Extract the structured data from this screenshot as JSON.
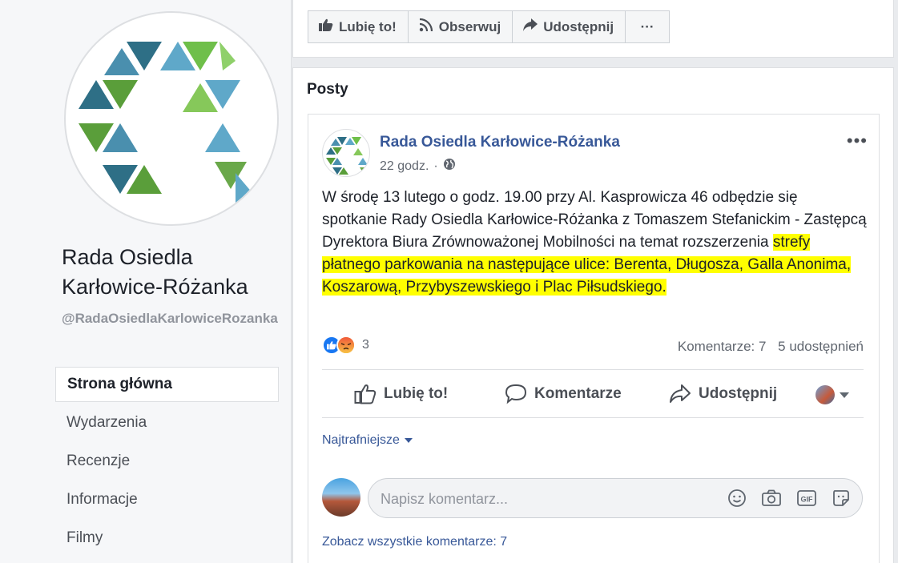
{
  "page": {
    "name": "Rada Osiedla Karłowice-Różanka",
    "handle": "@RadaOsiedlaKarlowiceRozanka"
  },
  "nav": {
    "items": [
      {
        "label": "Strona główna"
      },
      {
        "label": "Wydarzenia"
      },
      {
        "label": "Recenzje"
      },
      {
        "label": "Informacje"
      },
      {
        "label": "Filmy"
      }
    ]
  },
  "top_actions": {
    "like": "Lubię to!",
    "follow": "Obserwuj",
    "share": "Udostępnij",
    "more": "···"
  },
  "posts": {
    "title": "Posty",
    "post": {
      "author": "Rada Osiedla Karłowice-Różanka",
      "time": "22 godz.",
      "separator": "·",
      "text_plain": "W środę 13 lutego o godz. 19.00 przy Al. Kasprowicza 46 odbędzie się spotkanie Rady Osiedla Karłowice-Różanka z Tomaszem Stefanickim - Zastępcą Dyrektora Biura Zrównoważonej Mobilności na temat rozszerzenia ",
      "text_highlighted": "strefy płatnego parkowania na następujące ulice: Berenta, Długosza, Galla Anonima, Koszarową, Przybyszewskiego i Plac Piłsudskiego.",
      "reaction_count": "3",
      "comments_count": "Komentarze: 7",
      "shares_count": "5 udostępnień",
      "action_like": "Lubię to!",
      "action_comment": "Komentarze",
      "action_share": "Udostępnij",
      "sort_label": "Najtrafniejsze",
      "comment_placeholder": "Napisz komentarz...",
      "see_all": "Zobacz wszystkie komentarze: 7",
      "menu": "•••"
    }
  },
  "colors": {
    "link": "#385898",
    "highlight": "#ffff00",
    "background": "#e9ebee"
  }
}
